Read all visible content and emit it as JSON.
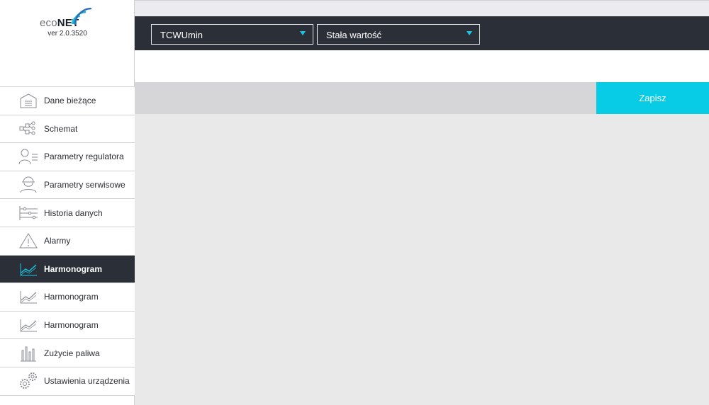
{
  "brand": {
    "logo_prefix": "eco",
    "logo_suffix": "NET",
    "version": "ver 2.0.3520",
    "accent": "#08cce6"
  },
  "sidebar": {
    "items": [
      {
        "label": "Dane bieżące",
        "icon": "home-icon",
        "active": false
      },
      {
        "label": "Schemat",
        "icon": "schema-icon",
        "active": false
      },
      {
        "label": "Parametry regulatora",
        "icon": "user-settings-icon",
        "active": false
      },
      {
        "label": "Parametry serwisowe",
        "icon": "service-worker-icon",
        "active": false
      },
      {
        "label": "Historia danych",
        "icon": "history-icon",
        "active": false
      },
      {
        "label": "Alarmy",
        "icon": "alarm-icon",
        "active": false
      },
      {
        "label": "Harmonogram",
        "icon": "schedule-chart-icon",
        "active": true
      },
      {
        "label": "Harmonogram",
        "icon": "schedule-chart-icon",
        "active": false
      },
      {
        "label": "Harmonogram",
        "icon": "schedule-chart-icon",
        "active": false
      },
      {
        "label": "Zużycie paliwa",
        "icon": "fuel-usage-icon",
        "active": false
      },
      {
        "label": "Ustawienia urządzenia",
        "icon": "gears-icon",
        "active": false
      }
    ]
  },
  "toolbar": {
    "parameter_select": {
      "value": "TCWUmin"
    },
    "mode_select": {
      "value": "Stała wartość"
    }
  },
  "actions": {
    "save_label": "Zapisz"
  }
}
